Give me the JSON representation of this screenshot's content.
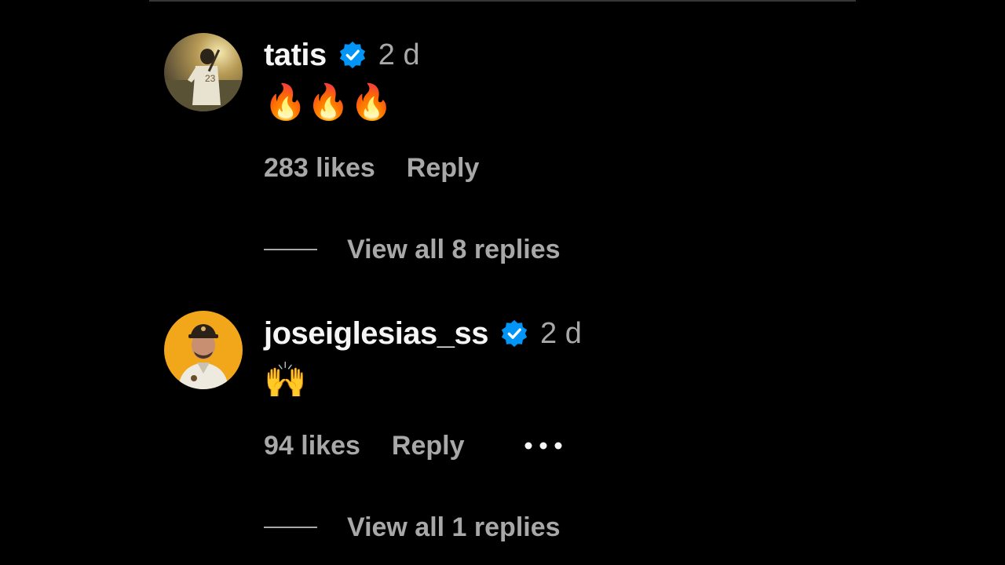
{
  "comments": [
    {
      "username": "tatis",
      "verified": true,
      "timestamp": "2 d",
      "text": "🔥🔥🔥",
      "likes": "283 likes",
      "reply_label": "Reply",
      "view_replies_label": "View all 8 replies",
      "avatar_icon": "avatar-baseball-player"
    },
    {
      "username": "joseiglesias_ss",
      "verified": true,
      "timestamp": "2 d",
      "text": "🙌",
      "likes": "94 likes",
      "reply_label": "Reply",
      "more_icon": "more-options-icon",
      "view_replies_label": "View all 1 replies",
      "avatar_icon": "avatar-baseball-player"
    }
  ],
  "colors": {
    "background": "#000000",
    "primary_text": "#f5f5f5",
    "secondary_text": "#a8a8a8",
    "verified_badge": "#0095f6"
  }
}
